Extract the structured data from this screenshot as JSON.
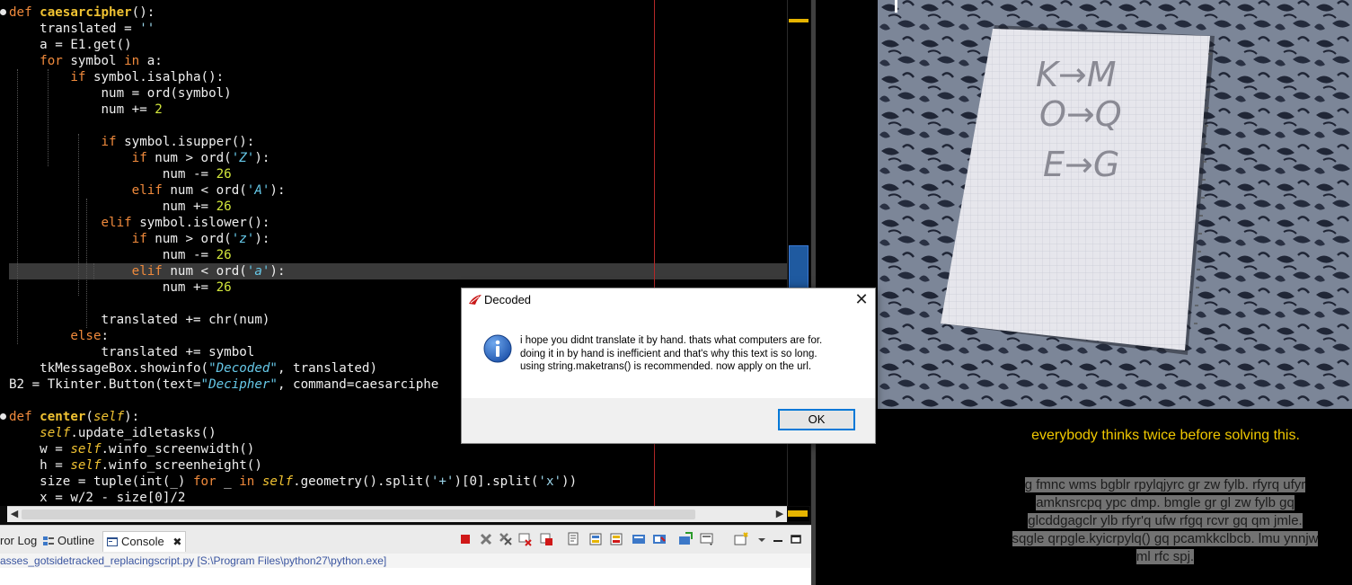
{
  "editor": {
    "lines": [
      {
        "tokens": [
          [
            "k",
            "def "
          ],
          [
            "f",
            "caesarcipher"
          ],
          [
            "",
            "():"
          ]
        ]
      },
      {
        "tokens": [
          [
            "",
            "    translated = "
          ],
          [
            "sq",
            "''"
          ]
        ]
      },
      {
        "tokens": [
          [
            "",
            "    a = E1.get()"
          ]
        ]
      },
      {
        "tokens": [
          [
            "k",
            "    for "
          ],
          [
            "",
            "symbol "
          ],
          [
            "k",
            "in "
          ],
          [
            "",
            "a:"
          ]
        ]
      },
      {
        "tokens": [
          [
            "k",
            "        if "
          ],
          [
            "",
            "symbol.isalpha():"
          ]
        ]
      },
      {
        "tokens": [
          [
            "",
            "            num = ord(symbol)"
          ]
        ]
      },
      {
        "tokens": [
          [
            "",
            "            num += "
          ],
          [
            "n",
            "2"
          ]
        ]
      },
      {
        "tokens": [
          [
            "",
            ""
          ]
        ]
      },
      {
        "tokens": [
          [
            "k",
            "            if "
          ],
          [
            "",
            "symbol.isupper():"
          ]
        ]
      },
      {
        "tokens": [
          [
            "k",
            "                if "
          ],
          [
            "",
            "num > ord("
          ],
          [
            "s",
            "'Z'"
          ],
          [
            "",
            "):"
          ]
        ]
      },
      {
        "tokens": [
          [
            "",
            "                    num -= "
          ],
          [
            "n",
            "26"
          ]
        ]
      },
      {
        "tokens": [
          [
            "k",
            "                elif "
          ],
          [
            "",
            "num < ord("
          ],
          [
            "s",
            "'A'"
          ],
          [
            "",
            "):"
          ]
        ]
      },
      {
        "tokens": [
          [
            "",
            "                    num += "
          ],
          [
            "n",
            "26"
          ]
        ]
      },
      {
        "tokens": [
          [
            "k",
            "            elif "
          ],
          [
            "",
            "symbol.islower():"
          ]
        ]
      },
      {
        "tokens": [
          [
            "k",
            "                if "
          ],
          [
            "",
            "num > ord("
          ],
          [
            "s",
            "'z'"
          ],
          [
            "",
            "):"
          ]
        ]
      },
      {
        "tokens": [
          [
            "",
            "                    num -= "
          ],
          [
            "n",
            "26"
          ]
        ]
      },
      {
        "tokens": [
          [
            "k",
            "                elif "
          ],
          [
            "",
            "num < ord("
          ],
          [
            "s",
            "'a'"
          ],
          [
            "",
            "):"
          ]
        ],
        "highlight": true
      },
      {
        "tokens": [
          [
            "",
            "                    num += "
          ],
          [
            "n",
            "26"
          ]
        ]
      },
      {
        "tokens": [
          [
            "",
            ""
          ]
        ]
      },
      {
        "tokens": [
          [
            "",
            "            translated += chr(num)"
          ]
        ]
      },
      {
        "tokens": [
          [
            "k",
            "        else"
          ],
          [
            "",
            ":"
          ]
        ]
      },
      {
        "tokens": [
          [
            "",
            "            translated += symbol"
          ]
        ]
      },
      {
        "tokens": [
          [
            "",
            "    tkMessageBox.showinfo("
          ],
          [
            "s",
            "\"Decoded\""
          ],
          [
            "",
            ", translated)"
          ]
        ]
      },
      {
        "tokens": [
          [
            "",
            "B2 = Tkinter.Button(text="
          ],
          [
            "s",
            "\"Decipher\""
          ],
          [
            "",
            ", command=caesarciphe"
          ]
        ]
      },
      {
        "tokens": [
          [
            "",
            ""
          ]
        ]
      },
      {
        "tokens": [
          [
            "k",
            "def "
          ],
          [
            "f",
            "center"
          ],
          [
            "",
            "("
          ],
          [
            "self",
            "self"
          ],
          [
            "",
            "):"
          ]
        ]
      },
      {
        "tokens": [
          [
            "self",
            "    self"
          ],
          [
            "",
            ".update_idletasks()"
          ]
        ]
      },
      {
        "tokens": [
          [
            "",
            "    w = "
          ],
          [
            "self",
            "self"
          ],
          [
            "",
            ".winfo_screenwidth()"
          ]
        ]
      },
      {
        "tokens": [
          [
            "",
            "    h = "
          ],
          [
            "self",
            "self"
          ],
          [
            "",
            ".winfo_screenheight()"
          ]
        ]
      },
      {
        "tokens": [
          [
            "",
            "    size = tuple(int(_) "
          ],
          [
            "k",
            "for "
          ],
          [
            "",
            "_ "
          ],
          [
            "k",
            "in "
          ],
          [
            "self",
            "self"
          ],
          [
            "",
            ".geometry().split("
          ],
          [
            "sq",
            "'+'"
          ],
          [
            "",
            ")[0].split("
          ],
          [
            "sq",
            "'x'"
          ],
          [
            "",
            "))"
          ]
        ]
      },
      {
        "tokens": [
          [
            "",
            "    x = w/2 - size[0]/2"
          ]
        ]
      }
    ]
  },
  "console": {
    "tabs": [
      {
        "label": "ror Log"
      },
      {
        "label": "Outline"
      },
      {
        "label": "Console"
      }
    ],
    "close_glyph": "✖",
    "status": "asses_gotsidetracked_replacingscript.py [S:\\Program Files\\python27\\python.exe]"
  },
  "dialog": {
    "title": "Decoded",
    "close_glyph": "✕",
    "message_lines": [
      "i hope you didnt translate it by hand. thats what computers are for.",
      "doing it in by hand is inefficient and that's why this text is so long.",
      "using string.maketrans() is recommended. now apply on the url."
    ],
    "ok_label": "OK"
  },
  "right_panel": {
    "notebook_lines": [
      "K→M",
      "O→Q",
      "E→G"
    ],
    "caption": "everybody thinks twice before solving this.",
    "cipher_lines": [
      "g fmnc wms bgblr rpylqjyrc gr zw fylb. rfyrq ufyr",
      "amknsrcpq ypc dmp. bmgle gr gl zw fylb gq",
      "glcddgagclr ylb rfyr'q ufw rfgq rcvr gq qm jmle.",
      "sqgle qrpgle.kyicrpylq() gq pcamkkclbcb. lmu ynnjw",
      "ml rfc spj."
    ]
  },
  "colors": {
    "keyword": "#f08a3c",
    "function": "#f0c232",
    "string": "#66c8e8",
    "number": "#d2e63c",
    "caption": "#f0c800",
    "margin_line": "#b42828"
  }
}
